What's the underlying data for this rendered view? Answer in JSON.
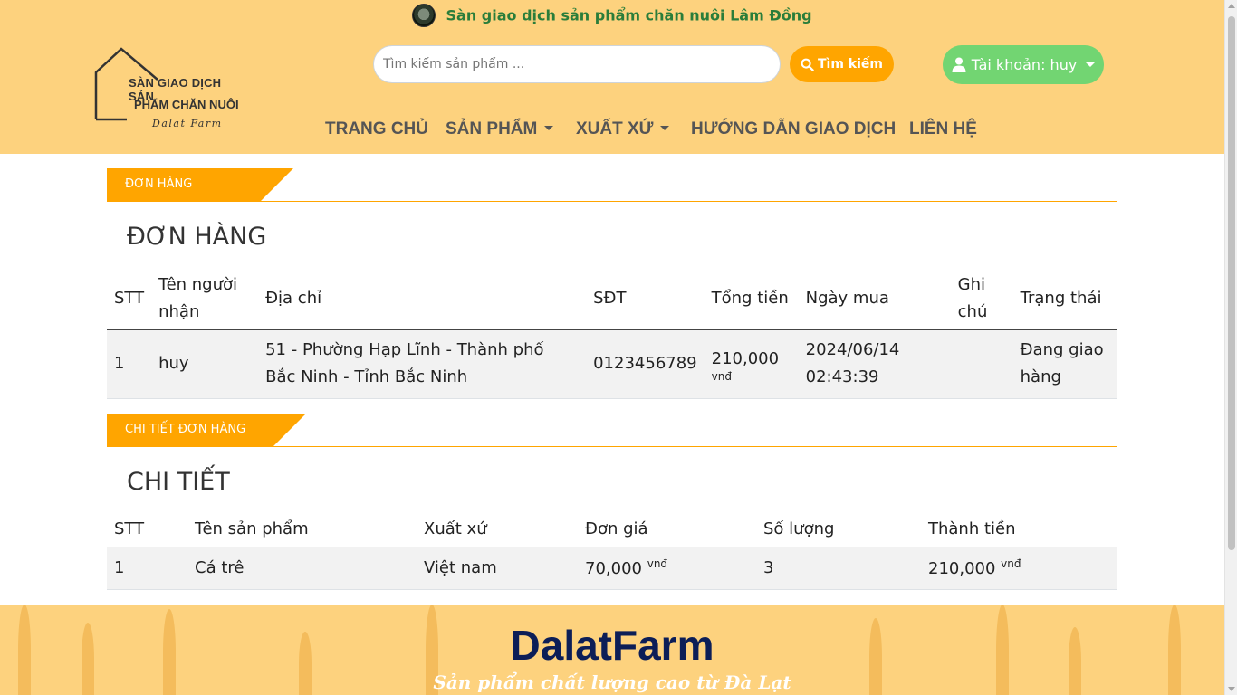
{
  "header": {
    "site_title": "Sàn giao dịch sản phẩm chăn nuôi Lâm Đồng",
    "logo": {
      "line1": "SÀN GIAO DỊCH SẢN",
      "line2": "PHẨM CHĂN NUÔI",
      "line3": "Dalat Farm"
    },
    "search": {
      "placeholder": "Tìm kiếm sản phẩm ...",
      "icon": "search-icon",
      "button_label": "Tìm kiếm"
    },
    "account": {
      "label": "Tài khoản: huy",
      "icon": "user-icon"
    },
    "nav": [
      {
        "label": "TRANG CHỦ",
        "dropdown": false
      },
      {
        "label": "SẢN PHẨM",
        "dropdown": true
      },
      {
        "label": "XUẤT XỨ",
        "dropdown": true
      },
      {
        "label": "HƯỚNG DẪN GIAO DỊCH",
        "dropdown": false
      },
      {
        "label": "LIÊN HỆ",
        "dropdown": false
      }
    ]
  },
  "orders": {
    "section_label": "ĐƠN HÀNG",
    "heading": "ĐƠN HÀNG",
    "columns": [
      "STT",
      "Tên người nhận",
      "Địa chỉ",
      "SĐT",
      "Tổng tiền",
      "Ngày mua",
      "Ghi chú",
      "Trạng thái"
    ],
    "rows": [
      {
        "stt": "1",
        "name": "huy",
        "address": "51 - Phường Hạp Lĩnh - Thành phố Bắc Ninh - Tỉnh Bắc Ninh",
        "phone": "0123456789",
        "total": "210,000",
        "currency": "vnđ",
        "date": "2024/06/14 02:43:39",
        "note": "",
        "status": "Đang giao hàng"
      }
    ]
  },
  "details": {
    "section_label": "CHI TIẾT ĐƠN HÀNG",
    "heading": "CHI TIẾT",
    "columns": [
      "STT",
      "Tên sản phẩm",
      "Xuất xứ",
      "Đơn giá",
      "Số lượng",
      "Thành tiền"
    ],
    "rows": [
      {
        "stt": "1",
        "product": "Cá trê",
        "origin": "Việt nam",
        "price": "70,000",
        "price_currency": "vnđ",
        "quantity": "3",
        "amount": "210,000",
        "amount_currency": "vnđ"
      }
    ]
  },
  "footer": {
    "brand": "DalatFarm",
    "slogan": "Sản phẩm chất lượng cao từ Đà Lạt"
  },
  "colors": {
    "header_bg": "#fdd27e",
    "accent_orange": "#ffa500",
    "account_green": "#72d572",
    "site_title_green": "#2a7d3a",
    "brand_navy": "#0c1e57"
  }
}
